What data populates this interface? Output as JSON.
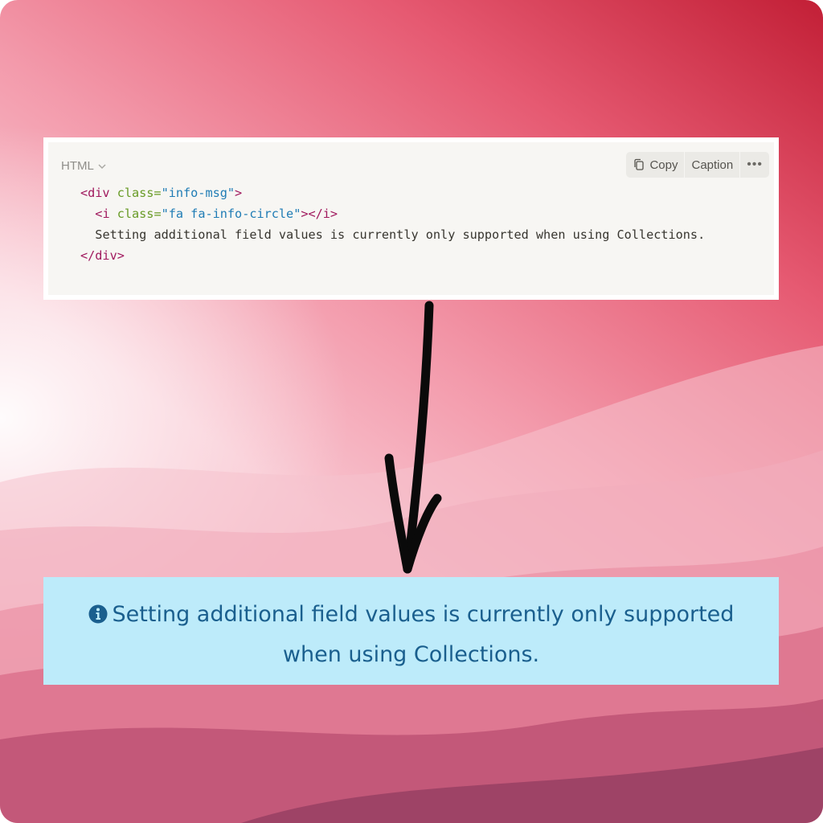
{
  "code_block": {
    "language": "HTML",
    "toolbar": {
      "copy_label": "Copy",
      "caption_label": "Caption",
      "more_label": "•••"
    },
    "lines": [
      {
        "indent": "",
        "parts": [
          {
            "cls": "tag",
            "text": "<div "
          },
          {
            "cls": "attr",
            "text": "class="
          },
          {
            "cls": "str",
            "text": "\"info-msg\""
          },
          {
            "cls": "tag",
            "text": ">"
          }
        ]
      },
      {
        "indent": "  ",
        "parts": [
          {
            "cls": "tag",
            "text": "<i "
          },
          {
            "cls": "attr",
            "text": "class="
          },
          {
            "cls": "str",
            "text": "\"fa fa-info-circle\""
          },
          {
            "cls": "tag",
            "text": "></i>"
          }
        ]
      },
      {
        "indent": "  ",
        "parts": [
          {
            "cls": "",
            "text": "Setting additional field values is currently only supported when using Collections."
          }
        ]
      },
      {
        "indent": "",
        "parts": [
          {
            "cls": "tag",
            "text": "</div>"
          }
        ]
      }
    ]
  },
  "info_message": {
    "icon": "info-circle-icon",
    "text": "Setting additional field values is currently only supported when using Collections."
  },
  "colors": {
    "info_background": "#bdebfa",
    "info_text": "#1a5f8e",
    "tag": "#a0185d",
    "attr": "#689b26",
    "string": "#1f7cb5"
  }
}
